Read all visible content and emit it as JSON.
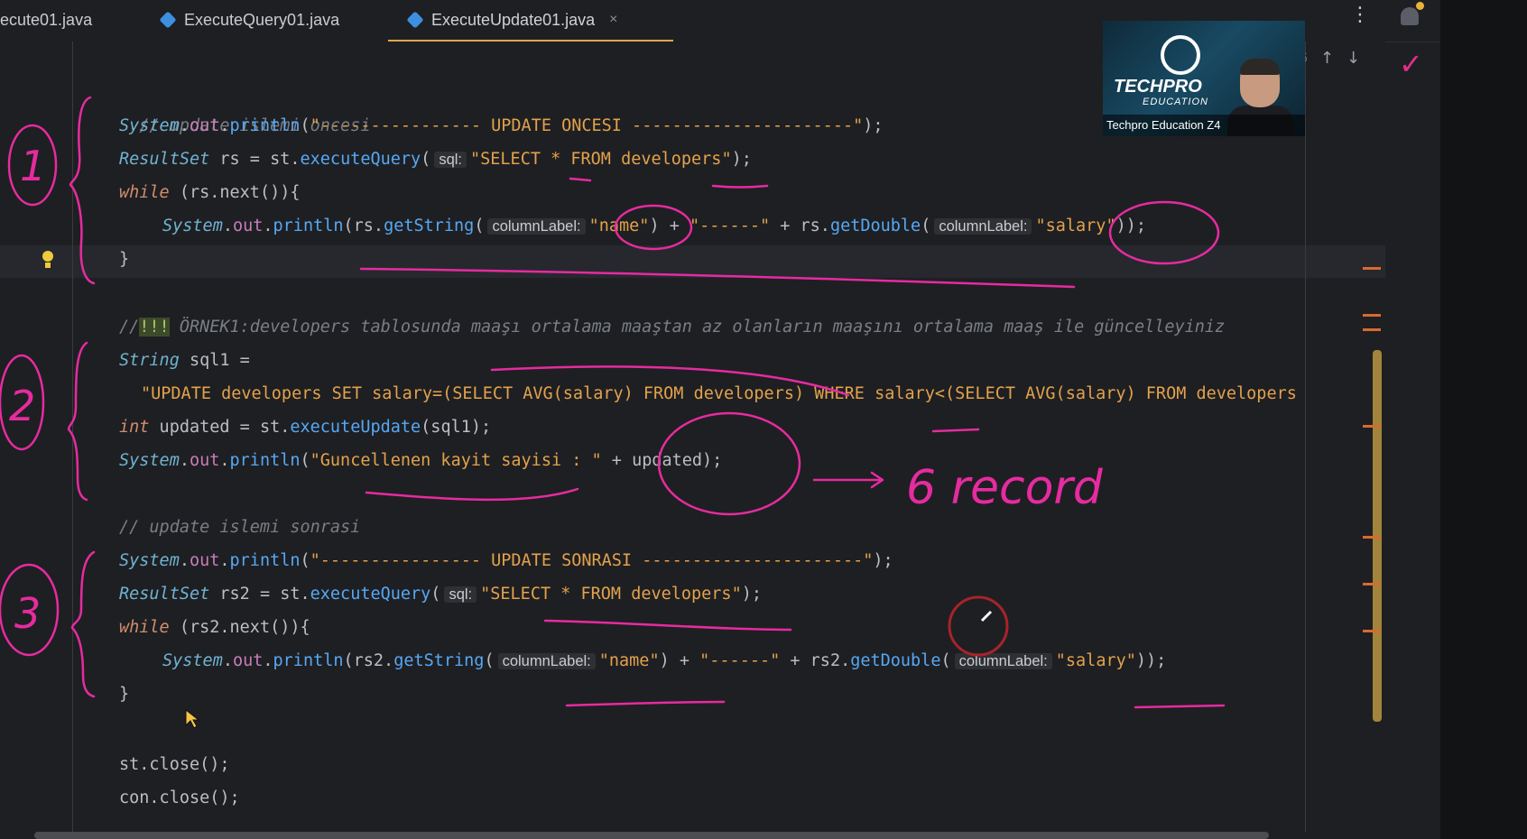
{
  "tabs": [
    {
      "label": "ecute01.java",
      "active": false
    },
    {
      "label": "ExecuteQuery01.java",
      "active": false
    },
    {
      "label": "ExecuteUpdate01.java",
      "active": true
    }
  ],
  "tab_close": "×",
  "menu_icon": "⋮",
  "nav": {
    "count": "6",
    "up": "↑",
    "down": "↓"
  },
  "video": {
    "brand": "TECHPRO",
    "brand_sub": "EDUCATION",
    "caption": "Techpro Education Z4"
  },
  "code": {
    "l1": "// update islemi oncesi",
    "l2_cls": "System",
    "l2_fld": "out",
    "l2_mth": "println",
    "l2_str": "\"---------------- UPDATE ONCESI ----------------------\"",
    "l3_ty": "ResultSet",
    "l3_var": "rs",
    "l3_obj": "st",
    "l3_mth": "executeQuery",
    "l3_hint": "sql:",
    "l3_str": "\"SELECT * FROM developers\"",
    "l4_kw": "while",
    "l4_body": "(rs.next()){",
    "l5_hint1": "columnLabel:",
    "l5_str1": "\"name\"",
    "l5_str2": "\"------\"",
    "l5_hint2": "columnLabel:",
    "l5_str3": "\"salary\"",
    "l6": "}",
    "l7_cm": "//",
    "l7_hl": "!!!",
    "l7_text": " ÖRNEK1:developers tablosunda maaşı ortalama maaştan az olanların maaşını ortalama maaş ile güncelleyiniz",
    "l8_ty": "String",
    "l8_rest": " sql1 =",
    "l9_str": "\"UPDATE developers SET salary=(SELECT AVG(salary) FROM developers) WHERE salary<(SELECT AVG(salary) FROM developers",
    "l10_ty": "int",
    "l10_rest": " updated = ",
    "l10_mth": "executeUpdate",
    "l10_end": "(sql1);",
    "l11_str": "\"Guncellenen kayit sayisi : \"",
    "l11_end": " + updated);",
    "l12": "// update islemi sonrasi",
    "l13_str": "\"---------------- UPDATE SONRASI ----------------------\"",
    "l14_ty": "ResultSet",
    "l14_var": "rs2",
    "l14_hint": "sql:",
    "l14_str": "\"SELECT * FROM developers\"",
    "l15_kw": "while",
    "l15_body": "(rs2.next()){",
    "l16_hint1": "columnLabel:",
    "l16_str1": "\"name\"",
    "l16_str2": "\"------\"",
    "l16_hint2": "columnLabel:",
    "l16_str3": "\"salary\"",
    "l17": "}",
    "l18": "st.close();",
    "l19": "con.close();"
  },
  "annotations": {
    "n1": "1",
    "n2": "2",
    "n3": "3",
    "result": "6 record"
  }
}
